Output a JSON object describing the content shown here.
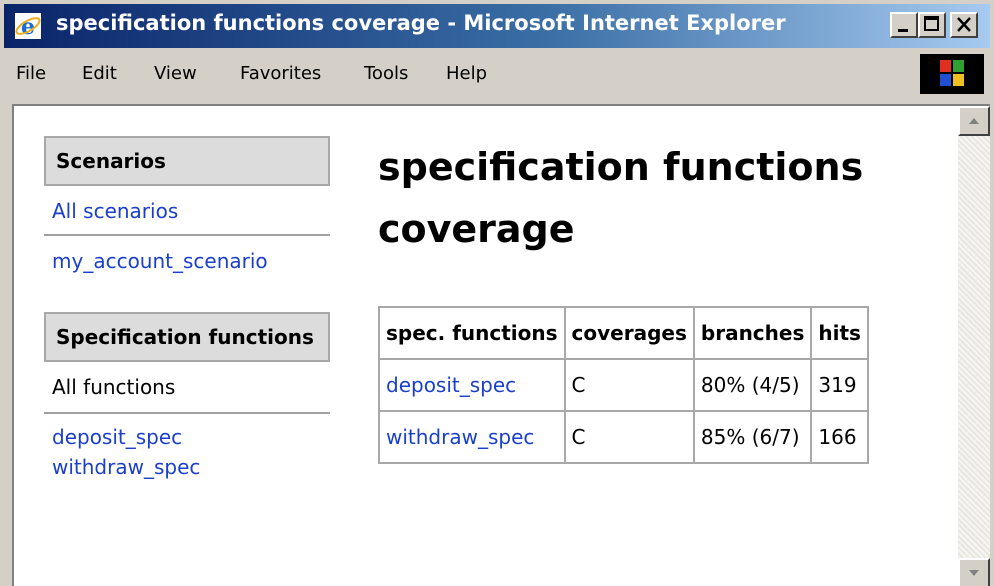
{
  "window": {
    "title": "specification functions coverage - Microsoft Internet Explorer"
  },
  "menu": {
    "items": [
      {
        "label": "File"
      },
      {
        "label": "Edit"
      },
      {
        "label": "View"
      },
      {
        "label": "Favorites"
      },
      {
        "label": "Tools"
      },
      {
        "label": "Help"
      }
    ]
  },
  "sidebar": {
    "scenarios_heading": "Scenarios",
    "scenarios": [
      {
        "label": "All scenarios"
      },
      {
        "label": "my_account_scenario"
      }
    ],
    "functions_heading": "Specification functions",
    "all_functions": "All functions",
    "functions": [
      {
        "label": "deposit_spec"
      },
      {
        "label": "withdraw_spec"
      }
    ]
  },
  "main": {
    "title": "specification functions coverage",
    "table": {
      "headers": [
        "spec. functions",
        "coverages",
        "branches",
        "hits"
      ],
      "rows": [
        {
          "function": "deposit_spec",
          "coverage": "C",
          "branches": "80% (4/5)",
          "hits": "319"
        },
        {
          "function": "withdraw_spec",
          "coverage": "C",
          "branches": "85% (6/7)",
          "hits": "166"
        }
      ]
    }
  },
  "colors": {
    "link": "#1a3fcc",
    "title_bar_start": "#0a246a",
    "title_bar_end": "#a6caf0",
    "chrome": "#d4d0c8"
  },
  "icons": {
    "app": "internet-explorer-icon",
    "logo": "windows-logo-icon"
  }
}
